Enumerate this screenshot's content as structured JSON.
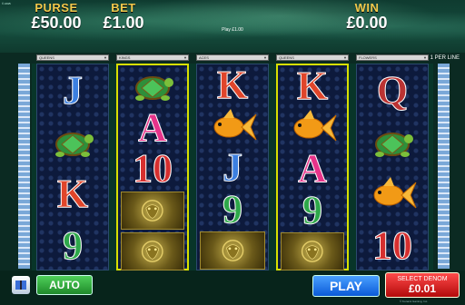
{
  "header": {
    "copyright": "© 2015",
    "purse": {
      "label": "PURSE",
      "value": "£50.00"
    },
    "bet": {
      "label": "BET",
      "value": "£1.00"
    },
    "win": {
      "label": "WIN",
      "value": "£0.00"
    },
    "play_amount": "Play £1.00"
  },
  "line_selectors": [
    "QUEENS",
    "KINGS",
    "ACES",
    "QUEENS",
    "FLOWERS"
  ],
  "lines_label": "1 PER LINE",
  "reels": [
    {
      "highlight": false,
      "symbols": [
        "J",
        "turtle",
        "K",
        "9"
      ]
    },
    {
      "highlight": true,
      "symbols": [
        "turtle",
        "A",
        "10",
        "dragon",
        "dragon"
      ]
    },
    {
      "highlight": false,
      "symbols": [
        "K",
        "goldfish",
        "J",
        "9",
        "dragon"
      ]
    },
    {
      "highlight": true,
      "symbols": [
        "K",
        "goldfish",
        "A",
        "9",
        "dragon"
      ]
    },
    {
      "highlight": false,
      "symbols": [
        "Q",
        "turtle",
        "goldfish",
        "10"
      ]
    }
  ],
  "controls": {
    "auto_label": "AUTO",
    "play_label": "PLAY",
    "denom_title": "SELECT DENOM",
    "denom_value": "£0.01"
  },
  "footer": "© Konami Gaming, Inc."
}
